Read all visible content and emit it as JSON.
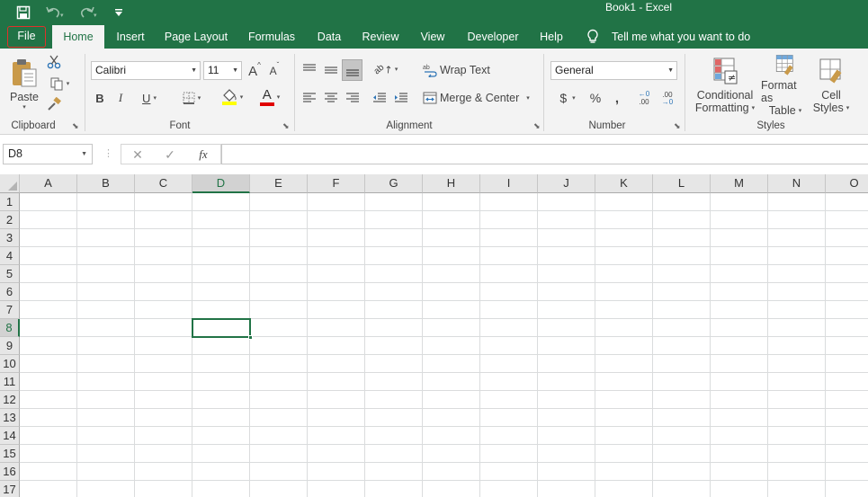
{
  "window": {
    "title": "Book1  -  Excel"
  },
  "quick_access": {
    "customize_caret": "▾"
  },
  "tabs": [
    {
      "label": "File"
    },
    {
      "label": "Home"
    },
    {
      "label": "Insert"
    },
    {
      "label": "Page Layout"
    },
    {
      "label": "Formulas"
    },
    {
      "label": "Data"
    },
    {
      "label": "Review"
    },
    {
      "label": "View"
    },
    {
      "label": "Developer"
    },
    {
      "label": "Help"
    },
    {
      "label": "Tell me what you want to do"
    }
  ],
  "clipboard": {
    "paste_label": "Paste",
    "group_label": "Clipboard"
  },
  "font": {
    "name": "Calibri",
    "size": "11",
    "bold": "B",
    "italic": "I",
    "underline": "U",
    "grow": "A",
    "shrink": "A",
    "font_color_letter": "A",
    "group_label": "Font",
    "highlight_color": "#ffff00",
    "font_color": "#e00000"
  },
  "alignment": {
    "wrap_text": "Wrap Text",
    "merge_center": "Merge & Center",
    "group_label": "Alignment",
    "orientation_glyph": "ab"
  },
  "number": {
    "format": "General",
    "currency": "$",
    "percent": "%",
    "comma": ",",
    "inc_decimal": ".00",
    "dec_decimal": ".00",
    "group_label": "Number"
  },
  "styles": {
    "conditional_line1": "Conditional",
    "conditional_line2": "Formatting",
    "format_table_line1": "Format as",
    "format_table_line2": "Table",
    "cell_styles_line1": "Cell",
    "cell_styles_line2": "Styles",
    "group_label": "Styles"
  },
  "formula_bar": {
    "name_box": "D8",
    "fx": "fx",
    "value": ""
  },
  "grid": {
    "columns": [
      "A",
      "B",
      "C",
      "D",
      "E",
      "F",
      "G",
      "H",
      "I",
      "J",
      "K",
      "L",
      "M",
      "N",
      "O"
    ],
    "rows": [
      "1",
      "2",
      "3",
      "4",
      "5",
      "6",
      "7",
      "8",
      "9",
      "10",
      "11",
      "12",
      "13",
      "14",
      "15",
      "16",
      "17"
    ],
    "selected_column": "D",
    "selected_row": "8"
  },
  "colors": {
    "accent": "#217346",
    "file_highlight": "#e0312a"
  }
}
